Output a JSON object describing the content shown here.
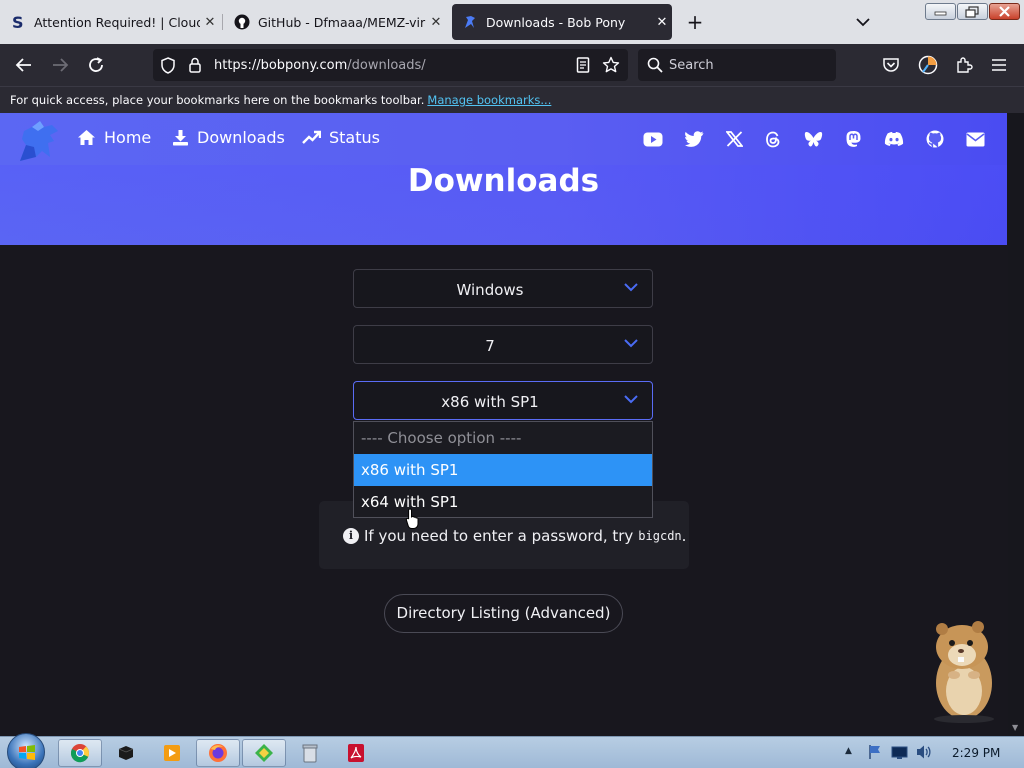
{
  "browser": {
    "tabs": [
      {
        "title": "Attention Required! | Cloudflare",
        "icon": "cloudflare-s-icon",
        "active": false
      },
      {
        "title": "GitHub - Dfmaaa/MEMZ-virus:",
        "icon": "github-icon",
        "active": false
      },
      {
        "title": "Downloads - Bob Pony",
        "icon": "bobpony-icon",
        "active": true
      }
    ],
    "new_tab": "+",
    "url_host": "https://bobpony.com",
    "url_path": "/downloads/",
    "search_placeholder": "Search",
    "bookmarks_message": "For quick access, place your bookmarks here on the bookmarks toolbar.",
    "bookmarks_link": "Manage bookmarks..."
  },
  "site": {
    "nav": [
      {
        "label": "Home",
        "icon": "home-icon"
      },
      {
        "label": "Downloads",
        "icon": "download-icon"
      },
      {
        "label": "Status",
        "icon": "trending-up-icon"
      }
    ],
    "social_icons": [
      "youtube-icon",
      "twitter-icon",
      "x-icon",
      "threads-icon",
      "bluesky-icon",
      "mastodon-icon",
      "discord-icon",
      "github-icon",
      "mail-icon"
    ],
    "title": "Downloads",
    "selects": {
      "os": "Windows",
      "version": "7",
      "edition": "x86 with SP1"
    },
    "dropdown_options": [
      "---- Choose option ----",
      "x86 with SP1",
      "x64 with SP1"
    ],
    "dropdown_selected_index": 1,
    "info_text": "If you need to enter a password, try",
    "info_code": "bigcdn",
    "info_end": ".",
    "directory_button": "Directory Listing (Advanced)"
  },
  "taskbar": {
    "apps": [
      "chrome-icon",
      "terminal-icon",
      "media-player-icon",
      "firefox-icon",
      "network-icon",
      "recycle-icon",
      "pdf-icon"
    ],
    "clock": "2:29 PM"
  },
  "colors": {
    "hero": "#5a5ef2",
    "selected_option": "#2d93f6",
    "link": "#52c3f2"
  }
}
